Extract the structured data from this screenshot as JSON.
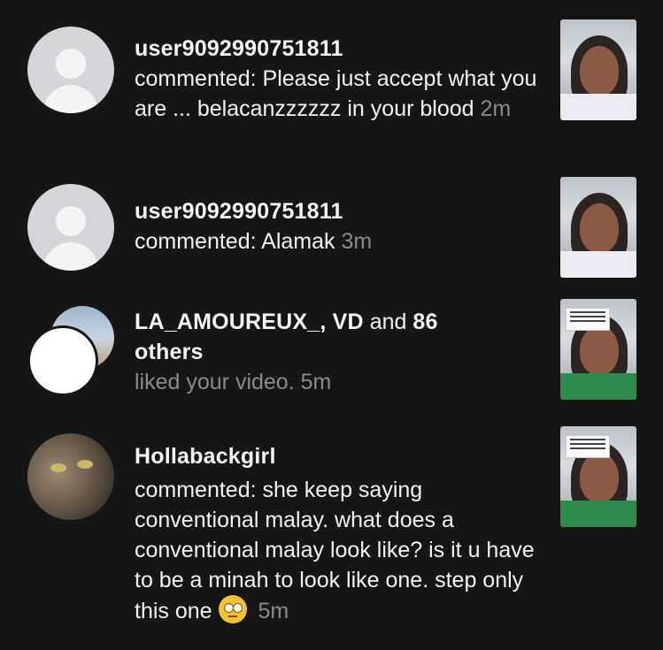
{
  "notifications": [
    {
      "username": "user9092990751811",
      "action": "commented:",
      "message": "Please just accept what you are ... belacanzzzzzz in your blood",
      "time": "2m",
      "avatar_icon": "default-avatar-icon"
    },
    {
      "username": "user9092990751811",
      "action": "commented:",
      "message": "Alamak",
      "time": "3m",
      "avatar_icon": "default-avatar-icon"
    },
    {
      "names": "LA_AMOUREUX_, VD",
      "and_text": "and",
      "count": "86",
      "others_text": "others",
      "message": "liked your video.",
      "time": "5m"
    },
    {
      "username": "Hollabackgirl",
      "action": "commented:",
      "message": "she keep saying conventional malay. what does a conventional malay look like? is it u have to be a minah to look like one. step only this one",
      "emoji": "eye-roll-emoji",
      "time": "5m"
    }
  ]
}
